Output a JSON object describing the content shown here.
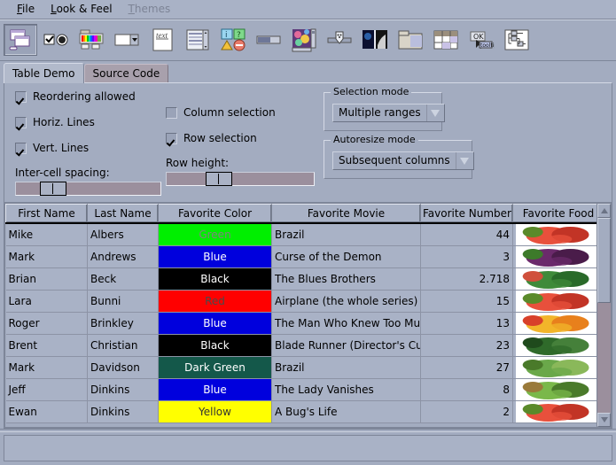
{
  "menubar": {
    "items": [
      {
        "label": "File",
        "mnemonic": "F",
        "disabled": false
      },
      {
        "label": "Look & Feel",
        "mnemonic": "L",
        "disabled": false
      },
      {
        "label": "Themes",
        "mnemonic": "T",
        "disabled": true
      }
    ]
  },
  "toolbar": {
    "buttons": [
      {
        "name": "internal-frame-demo-icon",
        "selected": true
      },
      {
        "name": "button-demo-icon",
        "selected": false
      },
      {
        "name": "color-chooser-demo-icon",
        "selected": false
      },
      {
        "name": "combobox-demo-icon",
        "selected": false
      },
      {
        "name": "text-demo-icon",
        "selected": false
      },
      {
        "name": "list-demo-icon",
        "selected": false
      },
      {
        "name": "option-pane-demo-icon",
        "selected": false
      },
      {
        "name": "progressbar-demo-icon",
        "selected": false
      },
      {
        "name": "scrollpane-demo-icon",
        "selected": false
      },
      {
        "name": "slider-demo-icon",
        "selected": false
      },
      {
        "name": "split-pane-demo-icon",
        "selected": false
      },
      {
        "name": "tabbed-pane-demo-icon",
        "selected": false
      },
      {
        "name": "table-demo-icon",
        "selected": false
      },
      {
        "name": "tooltip-demo-icon",
        "selected": false
      },
      {
        "name": "tree-demo-icon",
        "selected": false
      }
    ]
  },
  "tabs": [
    {
      "label": "Table Demo",
      "active": true
    },
    {
      "label": "Source Code",
      "active": false
    }
  ],
  "controls": {
    "checkboxes_left": [
      {
        "label": "Reordering allowed",
        "checked": true
      },
      {
        "label": "Horiz. Lines",
        "checked": true
      },
      {
        "label": "Vert. Lines",
        "checked": true
      }
    ],
    "intercell_spacing": {
      "label": "Inter-cell spacing:",
      "value_pct": 20
    },
    "checkboxes_mid": [
      {
        "label": "Column selection",
        "checked": false
      },
      {
        "label": "Row selection",
        "checked": true
      }
    ],
    "row_height": {
      "label": "Row height:",
      "value_pct": 30
    },
    "selection_mode": {
      "legend": "Selection mode",
      "value": "Multiple ranges"
    },
    "autoresize_mode": {
      "legend": "Autoresize mode",
      "value": "Subsequent columns"
    }
  },
  "table": {
    "columns": [
      "First Name",
      "Last Name",
      "Favorite Color",
      "Favorite Movie",
      "Favorite Number",
      "Favorite Food"
    ],
    "rows": [
      {
        "first": "Mike",
        "last": "Albers",
        "color": "Green",
        "color_hex": "#00ef00",
        "color_text": "#808080",
        "movie": "Brazil",
        "number": "44",
        "food": "strawberry"
      },
      {
        "first": "Mark",
        "last": "Andrews",
        "color": "Blue",
        "color_hex": "#0000dd",
        "color_text": "#ffffff",
        "movie": "Curse of the Demon",
        "number": "3",
        "food": "grapes"
      },
      {
        "first": "Brian",
        "last": "Beck",
        "color": "Black",
        "color_hex": "#000000",
        "color_text": "#ffffff",
        "movie": "The Blues Brothers",
        "number": "2.718",
        "food": "kale"
      },
      {
        "first": "Lara",
        "last": "Bunni",
        "color": "Red",
        "color_hex": "#ff0000",
        "color_text": "#4a4a4a",
        "movie": "Airplane (the whole series)",
        "number": "15",
        "food": "strawberry"
      },
      {
        "first": "Roger",
        "last": "Brinkley",
        "color": "Blue",
        "color_hex": "#0000dd",
        "color_text": "#ffffff",
        "movie": "The Man Who Knew Too Much",
        "number": "13",
        "food": "peach"
      },
      {
        "first": "Brent",
        "last": "Christian",
        "color": "Black",
        "color_hex": "#000000",
        "color_text": "#ffffff",
        "movie": "Blade Runner (Director's Cut)",
        "number": "23",
        "food": "broccoli"
      },
      {
        "first": "Mark",
        "last": "Davidson",
        "color": "Dark Green",
        "color_hex": "#14584a",
        "color_text": "#ffffff",
        "movie": "Brazil",
        "number": "27",
        "food": "asparagus"
      },
      {
        "first": "Jeff",
        "last": "Dinkins",
        "color": "Blue",
        "color_hex": "#0000dd",
        "color_text": "#ffffff",
        "movie": "The Lady Vanishes",
        "number": "8",
        "food": "kiwi"
      },
      {
        "first": "Ewan",
        "last": "Dinkins",
        "color": "Yellow",
        "color_hex": "#ffff00",
        "color_text": "#333333",
        "movie": "A Bug's Life",
        "number": "2",
        "food": "strawberry"
      }
    ]
  },
  "scrollbar": {
    "orientation": "vertical",
    "position_pct": 0
  }
}
